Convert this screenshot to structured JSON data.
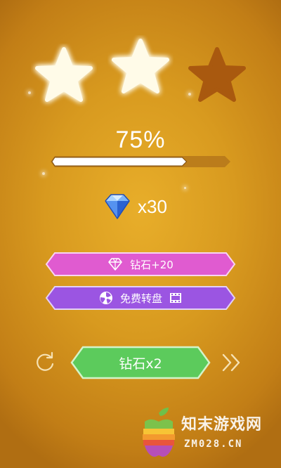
{
  "stars": {
    "earned": 2,
    "total": 3
  },
  "progress": {
    "label": "75%",
    "fraction": 0.75
  },
  "reward": {
    "icon": "diamond-icon",
    "count_label": "x30"
  },
  "buttons": {
    "diamond_bonus": {
      "label": "钻石+20",
      "icon": "diamond-outline-icon",
      "color": "#e05bd0"
    },
    "free_wheel": {
      "label": "免费转盘",
      "icon": "wheel-icon",
      "video_icon": "video-icon",
      "color": "#9b55e2"
    },
    "double": {
      "label": "钻石x2",
      "color": "#5ccb5c"
    },
    "retry_icon": "retry-icon",
    "next_icon": "fast-forward-icon"
  },
  "watermark": {
    "cn": "知末游戏网",
    "en": "ZM028.CN"
  }
}
